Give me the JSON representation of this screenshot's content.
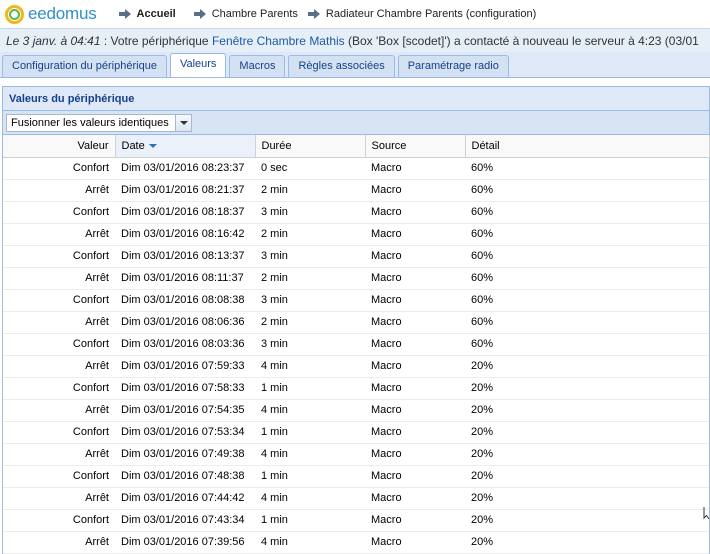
{
  "header": {
    "logo_text": "eedomus",
    "breadcrumb": [
      "Accueil",
      "Chambre Parents",
      "Radiateur Chambre Parents (configuration)"
    ]
  },
  "notice": {
    "date": "Le 3 janv. à 04:41",
    "text_before": " : Votre périphérique ",
    "device_link": "Fenêtre Chambre Mathis",
    "text_after": " (Box 'Box [scodet]') a contacté à nouveau le serveur à 4:23 (03/01"
  },
  "tabs": [
    {
      "label": "Configuration du périphérique",
      "active": false
    },
    {
      "label": "Valeurs",
      "active": true
    },
    {
      "label": "Macros",
      "active": false
    },
    {
      "label": "Règles associées",
      "active": false
    },
    {
      "label": "Paramétrage radio",
      "active": false
    }
  ],
  "panel": {
    "title": "Valeurs du périphérique",
    "merge_combo": "Fusionner les valeurs identiques"
  },
  "table": {
    "columns": [
      "Valeur",
      "Date",
      "Durée",
      "Source",
      "Détail"
    ],
    "sorted_column": "Date",
    "rows": [
      [
        "Confort",
        "Dim 03/01/2016 08:23:37",
        "0 sec",
        "Macro",
        "60%"
      ],
      [
        "Arrêt",
        "Dim 03/01/2016 08:21:37",
        "2 min",
        "Macro",
        "60%"
      ],
      [
        "Confort",
        "Dim 03/01/2016 08:18:37",
        "3 min",
        "Macro",
        "60%"
      ],
      [
        "Arrêt",
        "Dim 03/01/2016 08:16:42",
        "2 min",
        "Macro",
        "60%"
      ],
      [
        "Confort",
        "Dim 03/01/2016 08:13:37",
        "3 min",
        "Macro",
        "60%"
      ],
      [
        "Arrêt",
        "Dim 03/01/2016 08:11:37",
        "2 min",
        "Macro",
        "60%"
      ],
      [
        "Confort",
        "Dim 03/01/2016 08:08:38",
        "3 min",
        "Macro",
        "60%"
      ],
      [
        "Arrêt",
        "Dim 03/01/2016 08:06:36",
        "2 min",
        "Macro",
        "60%"
      ],
      [
        "Confort",
        "Dim 03/01/2016 08:03:36",
        "3 min",
        "Macro",
        "60%"
      ],
      [
        "Arrêt",
        "Dim 03/01/2016 07:59:33",
        "4 min",
        "Macro",
        "20%"
      ],
      [
        "Confort",
        "Dim 03/01/2016 07:58:33",
        "1 min",
        "Macro",
        "20%"
      ],
      [
        "Arrêt",
        "Dim 03/01/2016 07:54:35",
        "4 min",
        "Macro",
        "20%"
      ],
      [
        "Confort",
        "Dim 03/01/2016 07:53:34",
        "1 min",
        "Macro",
        "20%"
      ],
      [
        "Arrêt",
        "Dim 03/01/2016 07:49:38",
        "4 min",
        "Macro",
        "20%"
      ],
      [
        "Confort",
        "Dim 03/01/2016 07:48:38",
        "1 min",
        "Macro",
        "20%"
      ],
      [
        "Arrêt",
        "Dim 03/01/2016 07:44:42",
        "4 min",
        "Macro",
        "20%"
      ],
      [
        "Confort",
        "Dim 03/01/2016 07:43:34",
        "1 min",
        "Macro",
        "20%"
      ],
      [
        "Arrêt",
        "Dim 03/01/2016 07:39:56",
        "4 min",
        "Macro",
        "20%"
      ]
    ]
  }
}
